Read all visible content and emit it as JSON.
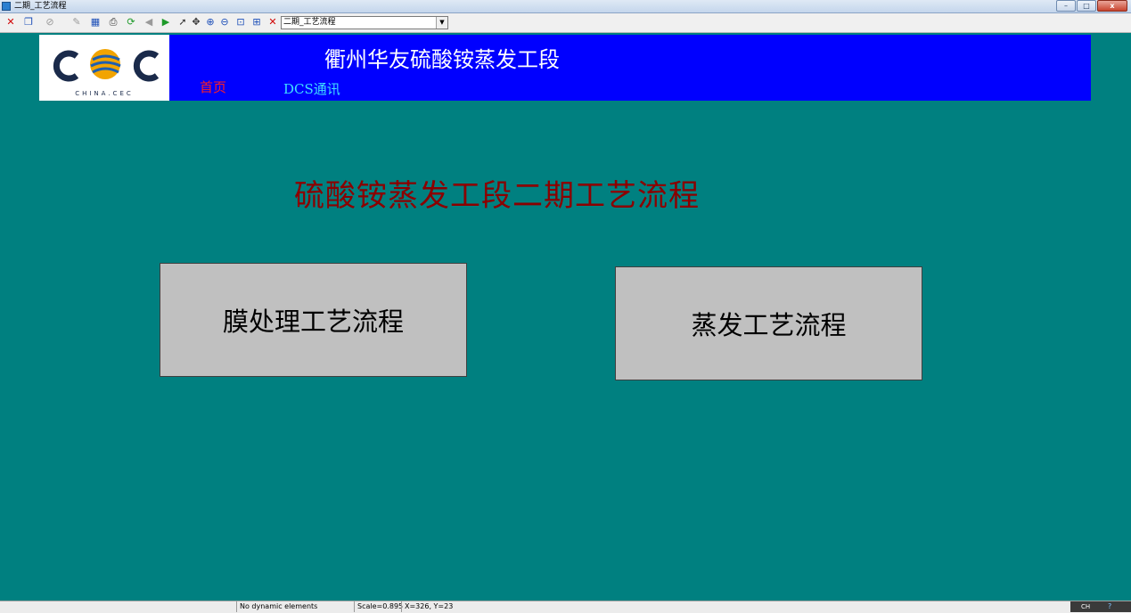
{
  "window": {
    "title": "二期_工艺流程",
    "buttons": {
      "minimize": "–",
      "maximize": "□",
      "close": "x"
    }
  },
  "toolbar": {
    "view_selector_value": "二期_工艺流程"
  },
  "header": {
    "logo_text": "CEC",
    "logo_subtext": "CHINA.CEC",
    "title": "衢州华友硫酸铵蒸发工段",
    "nav": {
      "home": "首页",
      "dcs": "DCS通讯"
    }
  },
  "main": {
    "title": "硫酸铵蒸发工段二期工艺流程",
    "buttons": {
      "membrane": "膜处理工艺流程",
      "evaporation": "蒸发工艺流程"
    }
  },
  "statusbar": {
    "dynamic": "No dynamic elements",
    "scale": "Scale=0.895",
    "coords": "X=326, Y=23",
    "tray_lang": "CH"
  },
  "colors": {
    "background": "#008080",
    "banner": "#0000ff",
    "main_title": "#8b0000",
    "button_face": "#c0c0c0",
    "nav_home": "#ff2020",
    "nav_dcs": "#40e0ff"
  }
}
